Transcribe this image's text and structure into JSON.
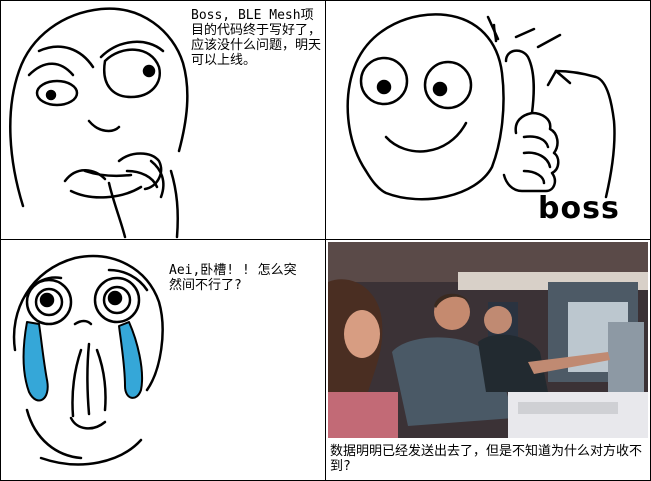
{
  "panels": {
    "p1": {
      "caption": "Boss, BLE Mesh项目的代码终于写好了，应该没什么问题，明天可以上线。"
    },
    "p2": {
      "boss_label": "boss"
    },
    "p3": {
      "caption": "Aei,卧槽! ! 怎么突然间不行了?"
    },
    "p4": {
      "caption": "数据明明已经发送出去了，但是不知道为什么对方收不到?"
    }
  },
  "colors": {
    "tears": "#35a7d8",
    "photo_bg": "#3b3236"
  }
}
